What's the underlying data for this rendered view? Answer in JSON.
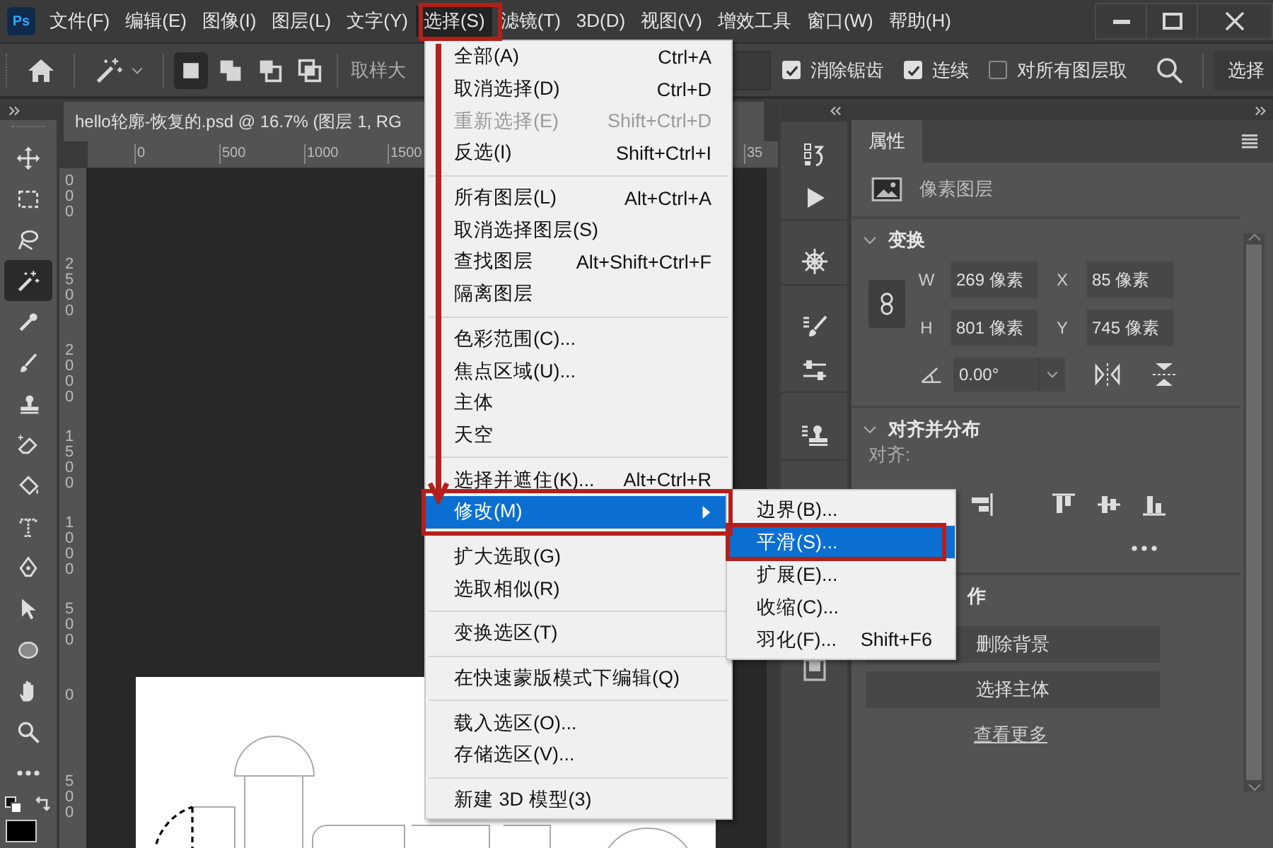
{
  "menubar": {
    "logo": "Ps",
    "items": [
      {
        "label": "文件(F)",
        "selected": false
      },
      {
        "label": "编辑(E)",
        "selected": false
      },
      {
        "label": "图像(I)",
        "selected": false
      },
      {
        "label": "图层(L)",
        "selected": false
      },
      {
        "label": "文字(Y)",
        "selected": false
      },
      {
        "label": "选择(S)",
        "selected": true
      },
      {
        "label": "滤镜(T)",
        "selected": false
      },
      {
        "label": "3D(D)",
        "selected": false
      },
      {
        "label": "视图(V)",
        "selected": false
      },
      {
        "label": "增效工具",
        "selected": false
      },
      {
        "label": "窗口(W)",
        "selected": false
      },
      {
        "label": "帮助(H)",
        "selected": false
      }
    ]
  },
  "options_bar": {
    "mode_buttons": [
      {
        "selected": true
      },
      {
        "selected": false
      },
      {
        "selected": false
      },
      {
        "selected": false
      }
    ],
    "sample_label": "取样大",
    "checkboxes": [
      {
        "label": "消除锯齿",
        "checked": true
      },
      {
        "label": "连续",
        "checked": true
      },
      {
        "label": "对所有图层取",
        "checked": false
      }
    ],
    "select_button": "选择"
  },
  "document_tab": {
    "title": "hello轮廓-恢复的.psd @ 16.7% (图层 1, RG"
  },
  "rulers": {
    "horizontal": [
      "0",
      "500",
      "1000",
      "1500",
      "35"
    ],
    "vertical": [
      "000",
      "2500",
      "2000",
      "1500",
      "1000",
      "500",
      "0",
      "500"
    ]
  },
  "toolbar": {
    "tools": [
      {
        "selected": false
      },
      {
        "selected": false
      },
      {
        "selected": false
      },
      {
        "selected": true
      },
      {
        "selected": false
      },
      {
        "selected": false
      },
      {
        "selected": false
      },
      {
        "selected": false
      },
      {
        "selected": false
      },
      {
        "selected": false
      },
      {
        "selected": false
      },
      {
        "selected": false
      },
      {
        "selected": false
      },
      {
        "selected": false
      },
      {
        "selected": false
      },
      {
        "selected": false
      }
    ]
  },
  "properties_panel": {
    "tab": "属性",
    "layer_type": "像素图层",
    "transform": {
      "title": "变换",
      "fields": [
        {
          "label": "W",
          "value": "269 像素"
        },
        {
          "label": "X",
          "value": "85 像素"
        },
        {
          "label": "H",
          "value": "801 像素"
        },
        {
          "label": "Y",
          "value": "745 像素"
        }
      ],
      "angle": "0.00°"
    },
    "align": {
      "title": "对齐并分布",
      "label": "对齐:"
    },
    "quick_actions": {
      "title": "作",
      "buttons": [
        "删除背景",
        "选择主体"
      ],
      "link": "查看更多"
    }
  },
  "menu": {
    "items": [
      {
        "kind": "item",
        "label": "全部(A)",
        "shortcut": "Ctrl+A",
        "disabled": false,
        "selected": false
      },
      {
        "kind": "item",
        "label": "取消选择(D)",
        "shortcut": "Ctrl+D",
        "disabled": false,
        "selected": false
      },
      {
        "kind": "item",
        "label": "重新选择(E)",
        "shortcut": "Shift+Ctrl+D",
        "disabled": true,
        "selected": false
      },
      {
        "kind": "item",
        "label": "反选(I)",
        "shortcut": "Shift+Ctrl+I",
        "disabled": false,
        "selected": false
      },
      {
        "kind": "separator"
      },
      {
        "kind": "item",
        "label": "所有图层(L)",
        "shortcut": "Alt+Ctrl+A",
        "disabled": false,
        "selected": false
      },
      {
        "kind": "item",
        "label": "取消选择图层(S)",
        "disabled": false,
        "selected": false
      },
      {
        "kind": "item",
        "label": "查找图层",
        "shortcut": "Alt+Shift+Ctrl+F",
        "disabled": false,
        "selected": false
      },
      {
        "kind": "item",
        "label": "隔离图层",
        "disabled": false,
        "selected": false
      },
      {
        "kind": "separator"
      },
      {
        "kind": "item",
        "label": "色彩范围(C)...",
        "disabled": false,
        "selected": false
      },
      {
        "kind": "item",
        "label": "焦点区域(U)...",
        "disabled": false,
        "selected": false
      },
      {
        "kind": "item",
        "label": "主体",
        "disabled": false,
        "selected": false
      },
      {
        "kind": "item",
        "label": "天空",
        "disabled": false,
        "selected": false
      },
      {
        "kind": "separator"
      },
      {
        "kind": "item",
        "label": "选择并遮住(K)...",
        "shortcut": "Alt+Ctrl+R",
        "disabled": false,
        "selected": false
      },
      {
        "kind": "submenu",
        "label": "修改(M)",
        "disabled": false,
        "selected": true
      },
      {
        "kind": "separator"
      },
      {
        "kind": "item",
        "label": "扩大选取(G)",
        "disabled": false,
        "selected": false
      },
      {
        "kind": "item",
        "label": "选取相似(R)",
        "disabled": false,
        "selected": false
      },
      {
        "kind": "separator"
      },
      {
        "kind": "item",
        "label": "变换选区(T)",
        "disabled": false,
        "selected": false
      },
      {
        "kind": "separator"
      },
      {
        "kind": "item",
        "label": "在快速蒙版模式下编辑(Q)",
        "disabled": false,
        "selected": false
      },
      {
        "kind": "separator"
      },
      {
        "kind": "item",
        "label": "载入选区(O)...",
        "disabled": false,
        "selected": false
      },
      {
        "kind": "item",
        "label": "存储选区(V)...",
        "disabled": false,
        "selected": false
      },
      {
        "kind": "separator"
      },
      {
        "kind": "item",
        "label": "新建 3D 模型(3)",
        "disabled": false,
        "selected": false
      }
    ]
  },
  "submenu": {
    "items": [
      {
        "kind": "item",
        "label": "边界(B)...",
        "disabled": false,
        "selected": false
      },
      {
        "kind": "item",
        "label": "平滑(S)...",
        "disabled": false,
        "selected": true
      },
      {
        "kind": "item",
        "label": "扩展(E)...",
        "disabled": false,
        "selected": false
      },
      {
        "kind": "item",
        "label": "收缩(C)...",
        "disabled": false,
        "selected": false
      },
      {
        "kind": "item",
        "label": "羽化(F)...",
        "shortcut": "Shift+F6",
        "disabled": false,
        "selected": false
      }
    ]
  }
}
